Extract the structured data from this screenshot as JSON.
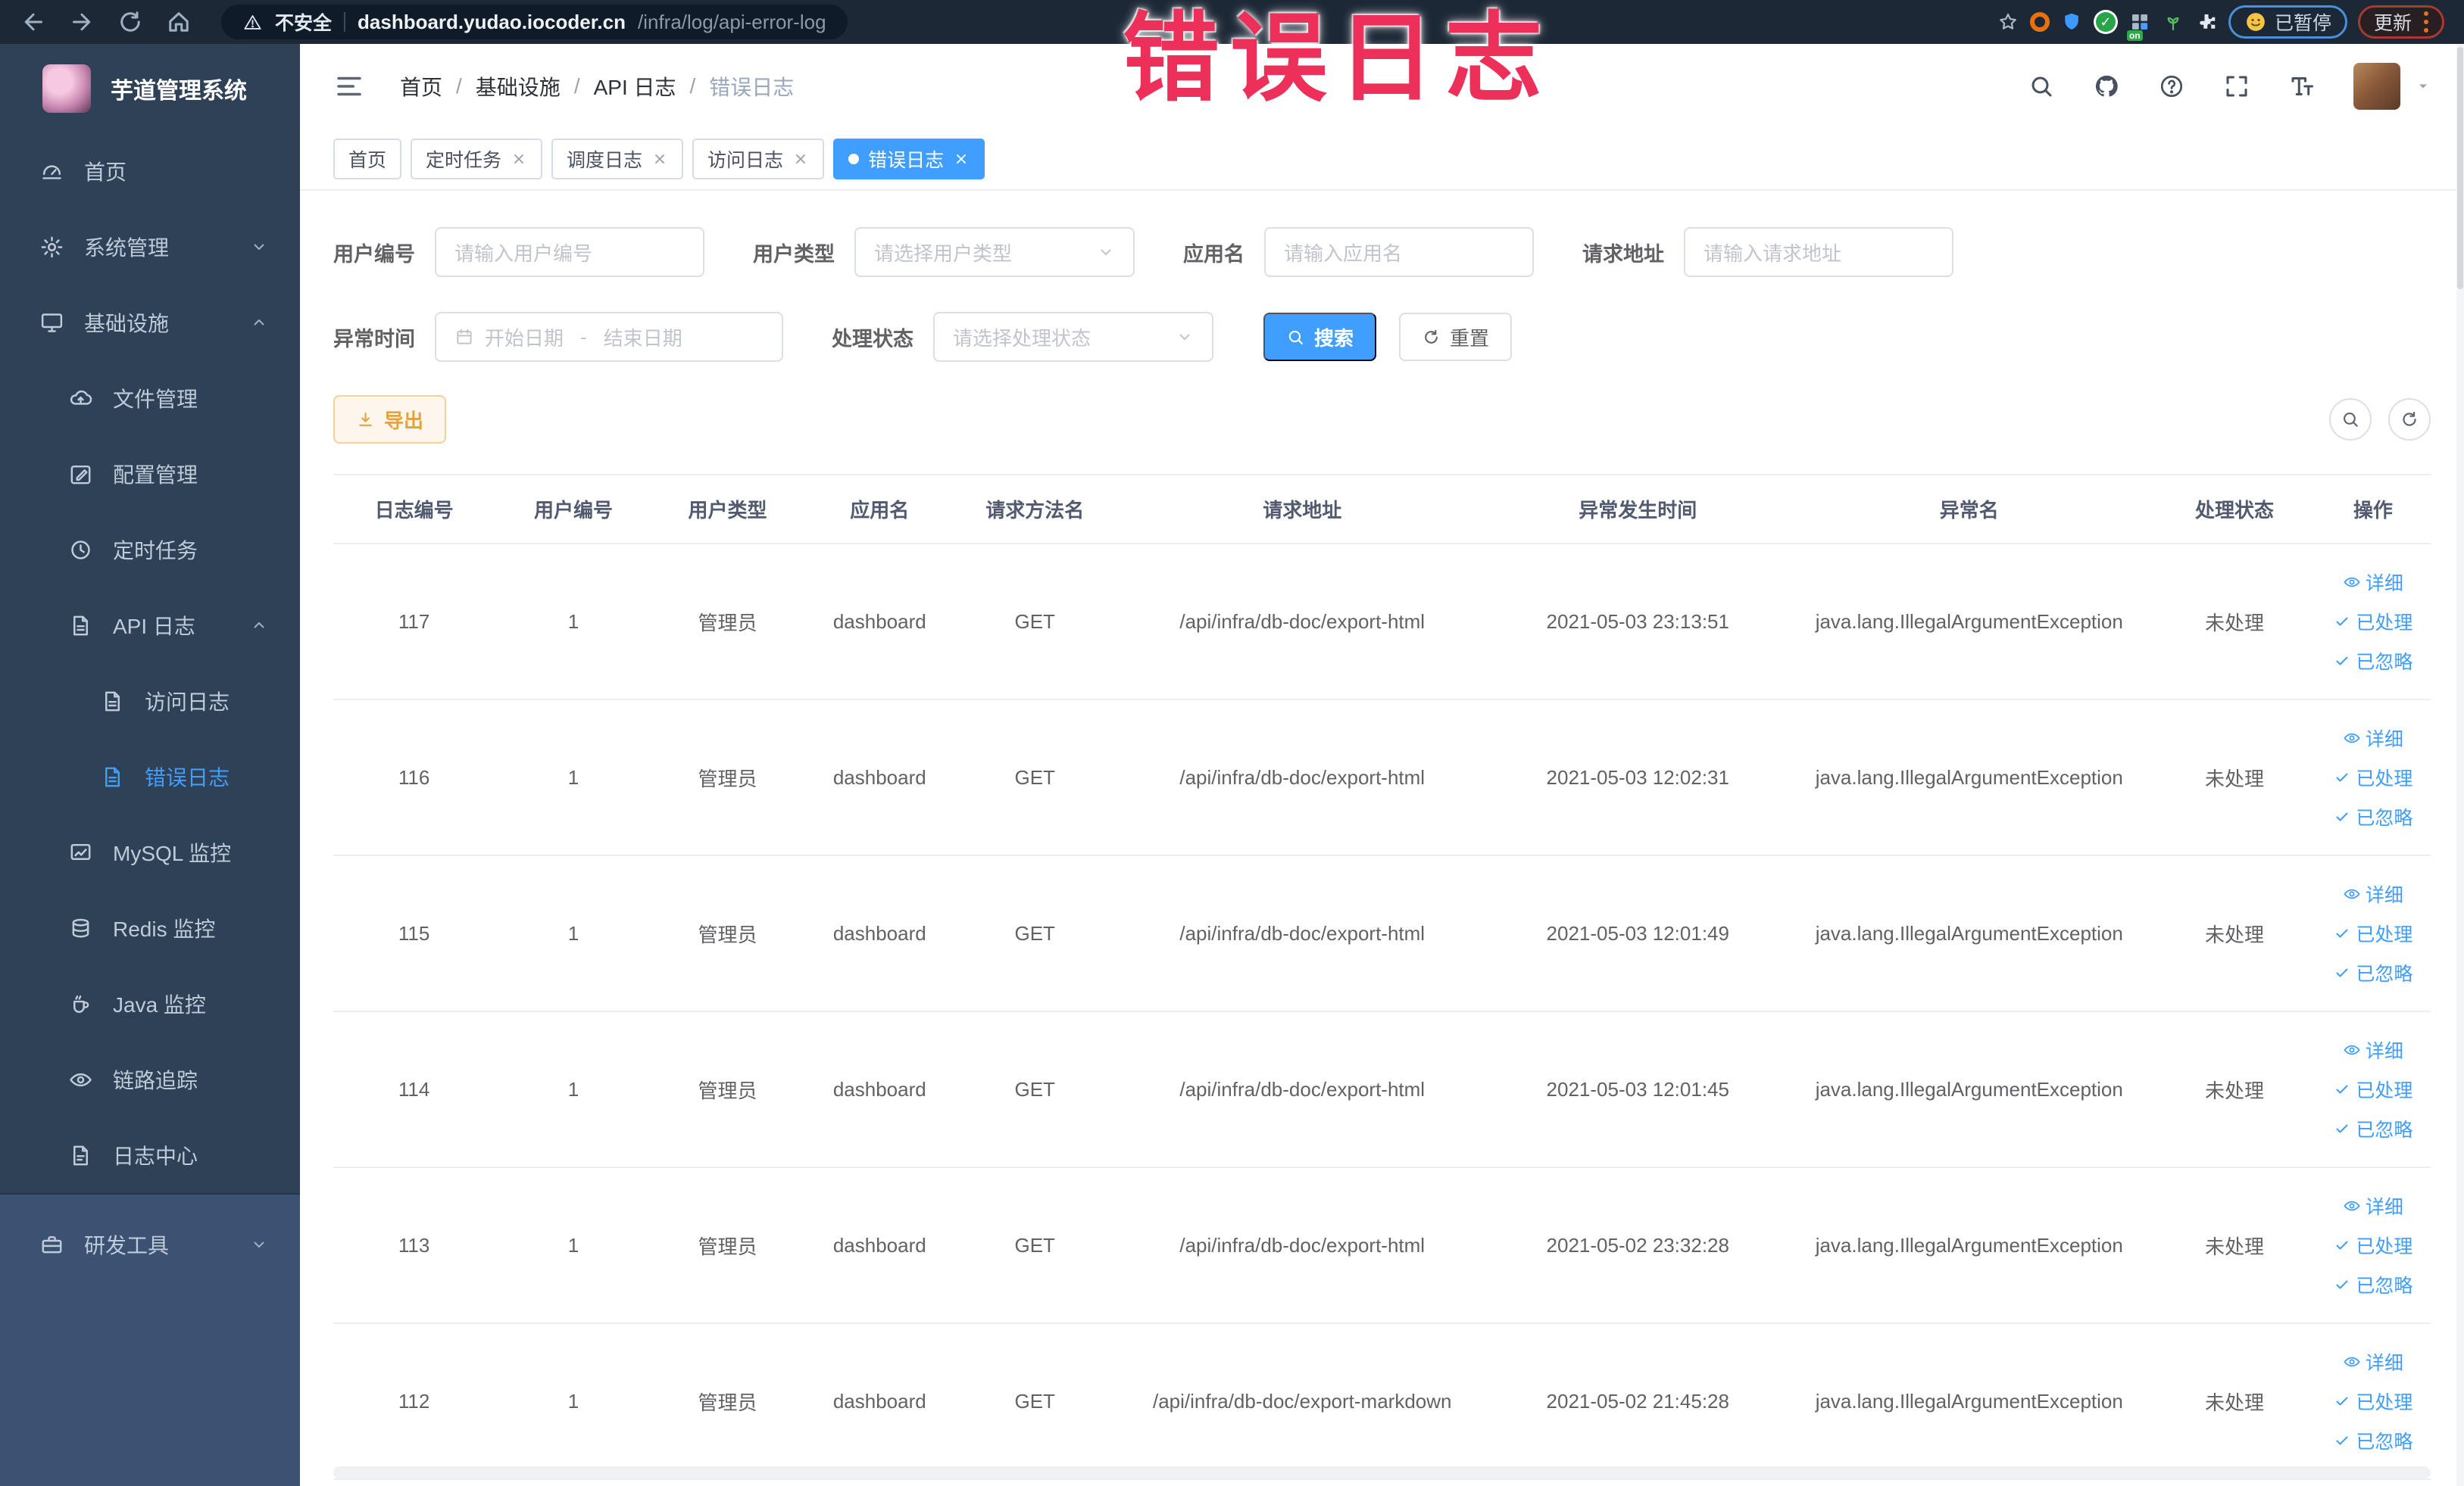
{
  "colors": {
    "accent": "#409eff",
    "sidebar_bg": "#2e4156",
    "warning": "#e6a23c",
    "stamp_pink": "#ec3059",
    "browser_bar": "#1d2836"
  },
  "stamp_text": "错误日志",
  "browser": {
    "nav_icons": [
      "back",
      "forward",
      "reload",
      "home"
    ],
    "security_label": "不安全",
    "url_domain": "dashboard.yudao.iocoder.cn",
    "url_path": "/infra/log/api-error-log",
    "extension_icons": [
      "star",
      "orange-ring",
      "shield",
      "green-check",
      "grid",
      "sprout",
      "puzzle"
    ],
    "paused_button": "已暂停",
    "update_button": "更新"
  },
  "sidebar": {
    "logo_title": "芋道管理系统",
    "menu": [
      {
        "label": "首页",
        "icon": "gauge",
        "level": 0
      },
      {
        "label": "系统管理",
        "icon": "gear",
        "level": 0,
        "chevron": "down"
      },
      {
        "label": "基础设施",
        "icon": "monitor",
        "level": 0,
        "chevron": "up"
      },
      {
        "label": "文件管理",
        "icon": "cloud",
        "level": 1
      },
      {
        "label": "配置管理",
        "icon": "edit",
        "level": 1
      },
      {
        "label": "定时任务",
        "icon": "history",
        "level": 1
      },
      {
        "label": "API 日志",
        "icon": "doc",
        "level": 1,
        "chevron": "up"
      },
      {
        "label": "访问日志",
        "icon": "doc",
        "level": 2
      },
      {
        "label": "错误日志",
        "icon": "doc",
        "level": 2,
        "active": true
      },
      {
        "label": "MySQL 监控",
        "icon": "chart",
        "level": 1
      },
      {
        "label": "Redis 监控",
        "icon": "stack",
        "level": 1
      },
      {
        "label": "Java 监控",
        "icon": "java",
        "level": 1
      },
      {
        "label": "链路追踪",
        "icon": "eye",
        "level": 1
      },
      {
        "label": "日志中心",
        "icon": "log",
        "level": 1
      },
      {
        "label": "研发工具",
        "icon": "tool",
        "level": 0,
        "chevron": "down",
        "section": "light"
      }
    ]
  },
  "topbar": {
    "breadcrumb": [
      "首页",
      "基础设施",
      "API 日志",
      "错误日志"
    ],
    "right_icons": [
      "search",
      "github",
      "help",
      "fullscreen",
      "font-size"
    ]
  },
  "tabs": [
    {
      "label": "首页",
      "closable": false,
      "active": false
    },
    {
      "label": "定时任务",
      "closable": true,
      "active": false
    },
    {
      "label": "调度日志",
      "closable": true,
      "active": false
    },
    {
      "label": "访问日志",
      "closable": true,
      "active": false
    },
    {
      "label": "错误日志",
      "closable": true,
      "active": true
    }
  ],
  "filters": {
    "user_id_label": "用户编号",
    "user_id_placeholder": "请输入用户编号",
    "user_type_label": "用户类型",
    "user_type_placeholder": "请选择用户类型",
    "app_name_label": "应用名",
    "app_name_placeholder": "请输入应用名",
    "request_url_label": "请求地址",
    "request_url_placeholder": "请输入请求地址",
    "exception_time_label": "异常时间",
    "date_start_placeholder": "开始日期",
    "date_separator": "-",
    "date_end_placeholder": "结束日期",
    "process_status_label": "处理状态",
    "process_status_placeholder": "请选择处理状态",
    "search_button": "搜索",
    "reset_button": "重置"
  },
  "toolbar": {
    "export_button": "导出"
  },
  "table": {
    "columns": [
      "日志编号",
      "用户编号",
      "用户类型",
      "应用名",
      "请求方法名",
      "请求地址",
      "异常发生时间",
      "异常名",
      "处理状态",
      "操作"
    ],
    "action_labels": [
      "详细",
      "已处理",
      "已忽略"
    ],
    "rows": [
      {
        "id": "117",
        "user_id": "1",
        "user_type": "管理员",
        "app": "dashboard",
        "method": "GET",
        "url": "/api/infra/db-doc/export-html",
        "time": "2021-05-03 23:13:51",
        "exception": "java.lang.IllegalArgumentException",
        "status": "未处理"
      },
      {
        "id": "116",
        "user_id": "1",
        "user_type": "管理员",
        "app": "dashboard",
        "method": "GET",
        "url": "/api/infra/db-doc/export-html",
        "time": "2021-05-03 12:02:31",
        "exception": "java.lang.IllegalArgumentException",
        "status": "未处理"
      },
      {
        "id": "115",
        "user_id": "1",
        "user_type": "管理员",
        "app": "dashboard",
        "method": "GET",
        "url": "/api/infra/db-doc/export-html",
        "time": "2021-05-03 12:01:49",
        "exception": "java.lang.IllegalArgumentException",
        "status": "未处理"
      },
      {
        "id": "114",
        "user_id": "1",
        "user_type": "管理员",
        "app": "dashboard",
        "method": "GET",
        "url": "/api/infra/db-doc/export-html",
        "time": "2021-05-03 12:01:45",
        "exception": "java.lang.IllegalArgumentException",
        "status": "未处理"
      },
      {
        "id": "113",
        "user_id": "1",
        "user_type": "管理员",
        "app": "dashboard",
        "method": "GET",
        "url": "/api/infra/db-doc/export-html",
        "time": "2021-05-02 23:32:28",
        "exception": "java.lang.IllegalArgumentException",
        "status": "未处理"
      },
      {
        "id": "112",
        "user_id": "1",
        "user_type": "管理员",
        "app": "dashboard",
        "method": "GET",
        "url": "/api/infra/db-doc/export-markdown",
        "time": "2021-05-02 21:45:28",
        "exception": "java.lang.IllegalArgumentException",
        "status": "未处理"
      }
    ]
  }
}
